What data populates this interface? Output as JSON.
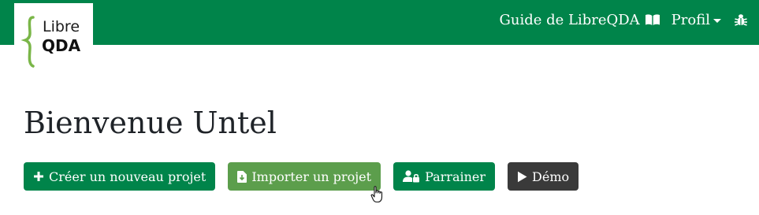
{
  "navbar": {
    "logo": {
      "word1": "Libre",
      "word2": "QDA"
    },
    "guide_label": "Guide de LibreQDA",
    "profile_label": "Profil",
    "icons": {
      "guide": "book-open-icon",
      "profile": "caret-down-icon",
      "bug": "bug-icon"
    }
  },
  "main": {
    "welcome": "Bienvenue Untel",
    "buttons": {
      "create": "Créer un nouveau projet",
      "import": "Importer un projet",
      "sponsor": "Parrainer",
      "demo": "Démo"
    }
  },
  "colors": {
    "brand_green": "#00844a",
    "import_green": "#5c9e4c",
    "demo_dark": "#3a3a3a",
    "logo_brace": "#7ab648"
  }
}
